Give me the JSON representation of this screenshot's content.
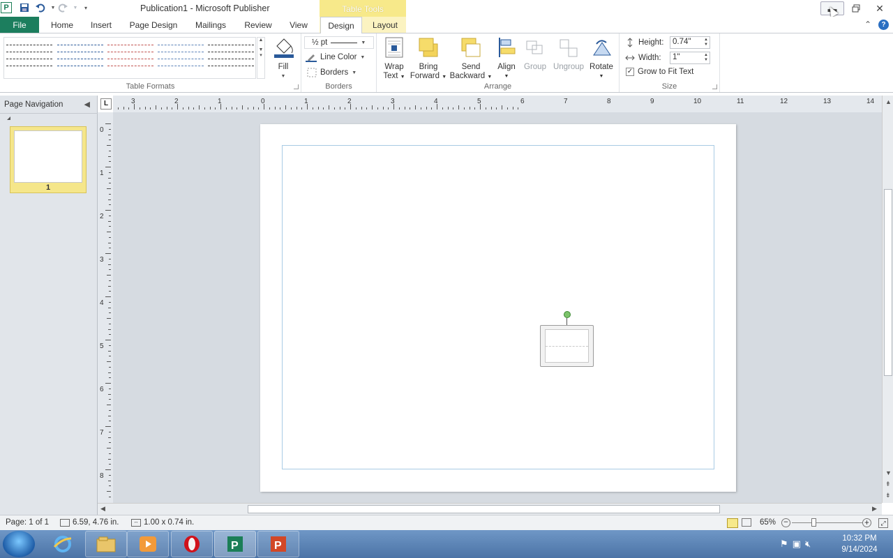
{
  "window": {
    "title": "Publication1 - Microsoft Publisher",
    "contextual_tab_title": "Table Tools",
    "app_icon": "publisher-icon"
  },
  "quick_access": {
    "icons": [
      "save-icon",
      "undo-icon",
      "redo-icon",
      "customize-icon"
    ]
  },
  "tabs": {
    "file": "File",
    "items": [
      "Home",
      "Insert",
      "Page Design",
      "Mailings",
      "Review",
      "View"
    ],
    "context": [
      "Design",
      "Layout"
    ],
    "active": "Design"
  },
  "ribbon": {
    "table_formats_label": "Table Formats",
    "borders_label": "Borders",
    "arrange_label": "Arrange",
    "size_label": "Size",
    "fill_label": "Fill",
    "line_weight": "½ pt",
    "line_color_label": "Line Color",
    "borders_btn_label": "Borders",
    "wrap_text_label": [
      "Wrap",
      "Text"
    ],
    "bring_forward_label": [
      "Bring",
      "Forward"
    ],
    "send_backward_label": [
      "Send",
      "Backward"
    ],
    "align_label": "Align",
    "group_label": "Group",
    "ungroup_label": "Ungroup",
    "rotate_label": "Rotate",
    "height_label": "Height:",
    "height_value": "0.74\"",
    "width_label": "Width:",
    "width_value": "1\"",
    "grow_to_fit_label": "Grow to Fit Text",
    "grow_to_fit_checked": true,
    "table_style_colors": [
      "#333333",
      "#2a5a9a",
      "#c0504d",
      "#5b82b8",
      "#333333"
    ]
  },
  "nav_pane": {
    "title": "Page Navigation",
    "pages": [
      "1"
    ]
  },
  "rulers": {
    "corner": "L",
    "horizontal_numbers": [
      "3",
      "2",
      "1",
      "0",
      "1",
      "2",
      "3",
      "4",
      "5",
      "6",
      "7",
      "8",
      "9",
      "10",
      "11",
      "12",
      "13",
      "14"
    ],
    "vertical_numbers": [
      "0",
      "1",
      "2",
      "3",
      "4",
      "5",
      "6",
      "7",
      "8"
    ]
  },
  "status_bar": {
    "page": "Page: 1 of 1",
    "position": "6.59, 4.76 in.",
    "size": "1.00 x 0.74 in.",
    "zoom": "65%",
    "zoom_fraction": 0.28
  },
  "taskbar": {
    "apps": [
      "internet-explorer-icon",
      "windows-explorer-icon",
      "media-player-icon",
      "opera-icon",
      "publisher-icon",
      "powerpoint-icon"
    ],
    "time": "10:32 PM",
    "date": "9/14/2024"
  },
  "colors": {
    "file_tab": "#1c7e5e",
    "contextual_tab": "#f7e98a",
    "selected_page": "#f5e68a",
    "rotate_handle": "#7cc36b"
  }
}
